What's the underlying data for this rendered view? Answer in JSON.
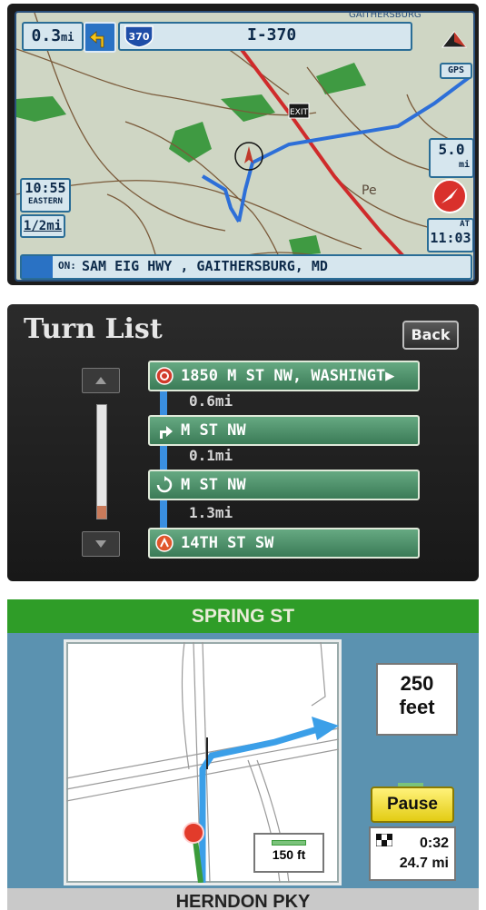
{
  "map": {
    "distance": "0.3",
    "distance_unit": "mi",
    "route_shield": "370",
    "road_name": "I-370",
    "corner_city": "GAITHERSBURG",
    "gps_label": "GPS",
    "exit_label": "EXIT",
    "time": "10:55",
    "timezone": "EASTERN",
    "scale": "1/2mi",
    "remaining_distance": "5.0",
    "remaining_unit": "mi",
    "at_label": "AT",
    "eta": "11:03",
    "on_label": "ON:",
    "location": "SAM EIG HWY , GAITHERSBURG, MD",
    "map_text_fragment": "Pe",
    "colors": {
      "route": "#2d6fd8",
      "highway": "#cf2b2b",
      "park": "#3f9a42"
    }
  },
  "turn_list": {
    "title": "Turn List",
    "back_label": "Back",
    "items": [
      {
        "label": "1850 M ST NW, WASHINGT▶",
        "icon": "destination-icon"
      },
      {
        "label": "M ST NW",
        "icon": "turn-right-icon"
      },
      {
        "label": "M ST NW",
        "icon": "u-turn-icon"
      },
      {
        "label": "14TH ST SW",
        "icon": "start-icon"
      }
    ],
    "distances": [
      "0.6mi",
      "0.1mi",
      "1.3mi"
    ]
  },
  "nav": {
    "next_street": "SPRING ST",
    "current_street": "HERNDON PKY",
    "turn_distance_value": "250",
    "turn_distance_unit": "feet",
    "pause_label": "Pause",
    "map_scale": "150 ft",
    "time_remaining": "0:32",
    "distance_remaining": "24.7 mi",
    "colors": {
      "route": "#3b9fe8",
      "topbar": "#2f9d28",
      "pause": "#f2e23a"
    }
  }
}
